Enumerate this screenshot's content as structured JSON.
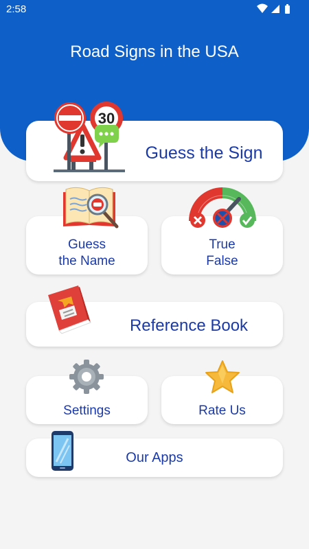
{
  "status_bar": {
    "time": "2:58"
  },
  "header": {
    "title": "Road Signs in the USA"
  },
  "menu": {
    "guess_sign": "Guess the Sign",
    "guess_name_line1": "Guess",
    "guess_name_line2": "the Name",
    "true_false_line1": "True",
    "true_false_line2": "False",
    "reference_book": "Reference Book",
    "settings": "Settings",
    "rate_us": "Rate Us",
    "our_apps": "Our Apps"
  },
  "sign_icon": {
    "speed_limit": "30"
  },
  "icons": [
    "wifi-icon",
    "cell-signal-icon",
    "battery-icon",
    "road-signs-icon",
    "open-book-icon",
    "gauge-icon",
    "red-book-icon",
    "gear-icon",
    "star-icon",
    "smartphone-icon"
  ],
  "colors": {
    "header_blue": "#0f5fc9",
    "text_blue": "#1b3aa8",
    "background": "#f4f4f4",
    "card": "#ffffff"
  }
}
